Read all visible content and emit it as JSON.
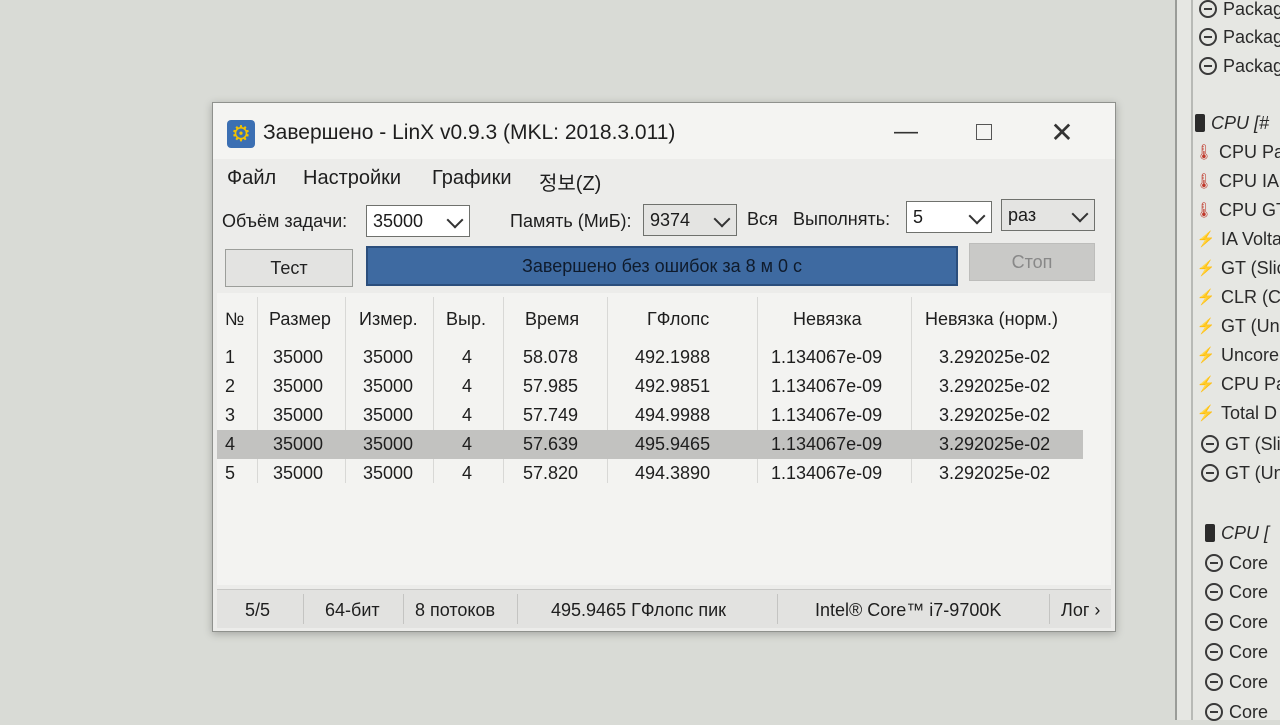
{
  "window": {
    "title": "Завершено - LinX v0.9.3 (MKL: 2018.3.011)",
    "minimize": "—",
    "close": "✕"
  },
  "menu": [
    "Файл",
    "Настройки",
    "Графики",
    "정보(Z)"
  ],
  "controls": {
    "task_size_label": "Объём задачи:",
    "task_size_value": "35000",
    "memory_label": "Память (МиБ):",
    "memory_value": "9374",
    "all_label": "Вся",
    "run_label": "Выполнять:",
    "run_count": "5",
    "run_unit": "раз"
  },
  "buttons": {
    "test": "Тест",
    "stop": "Стоп"
  },
  "progress": {
    "text": "Завершено без ошибок за 8 м 0 с",
    "fraction": 1.0
  },
  "table": {
    "columns": [
      "№",
      "Размер",
      "Измер.",
      "Выр.",
      "Время",
      "ГФлопс",
      "Невязка",
      "Невязка (норм.)"
    ],
    "rows": [
      [
        "1",
        "35000",
        "35000",
        "4",
        "58.078",
        "492.1988",
        "1.134067e-09",
        "3.292025e-02"
      ],
      [
        "2",
        "35000",
        "35000",
        "4",
        "57.985",
        "492.9851",
        "1.134067e-09",
        "3.292025e-02"
      ],
      [
        "3",
        "35000",
        "35000",
        "4",
        "57.749",
        "494.9988",
        "1.134067e-09",
        "3.292025e-02"
      ],
      [
        "4",
        "35000",
        "35000",
        "4",
        "57.639",
        "495.9465",
        "1.134067e-09",
        "3.292025e-02"
      ],
      [
        "5",
        "35000",
        "35000",
        "4",
        "57.820",
        "494.3890",
        "1.134067e-09",
        "3.292025e-02"
      ]
    ],
    "selected_row": 4
  },
  "status": {
    "progress": "5/5",
    "bits": "64-бит",
    "threads": "8 потоков",
    "peak": "495.9465 ГФлопс пик",
    "cpu": "Intel® Core™ i7-9700K",
    "log": "Лог ›"
  },
  "side_panel": {
    "items": [
      {
        "icon": "minus-circle-icon",
        "label": "Package"
      },
      {
        "icon": "minus-circle-icon",
        "label": "Package"
      },
      {
        "icon": "minus-circle-icon",
        "label": "Package"
      },
      {
        "icon": "chip-icon",
        "label": "CPU [#"
      },
      {
        "icon": "thermometer-icon",
        "label": "CPU Pac"
      },
      {
        "icon": "thermometer-icon",
        "label": "CPU IA"
      },
      {
        "icon": "thermometer-icon",
        "label": "CPU GT"
      },
      {
        "icon": "lightning-icon",
        "label": "IA Volta"
      },
      {
        "icon": "lightning-icon",
        "label": "GT (Slic"
      },
      {
        "icon": "lightning-icon",
        "label": "CLR (C"
      },
      {
        "icon": "lightning-icon",
        "label": "GT (Un"
      },
      {
        "icon": "lightning-icon",
        "label": "Uncore"
      },
      {
        "icon": "lightning-icon",
        "label": "CPU Pa"
      },
      {
        "icon": "lightning-icon",
        "label": "Total D"
      },
      {
        "icon": "minus-circle-icon",
        "label": "GT (Slic"
      },
      {
        "icon": "minus-circle-icon",
        "label": "GT (Un"
      },
      {
        "icon": "chip-icon",
        "label": "CPU ["
      },
      {
        "icon": "minus-circle-icon",
        "label": "Core"
      },
      {
        "icon": "minus-circle-icon",
        "label": "Core"
      },
      {
        "icon": "minus-circle-icon",
        "label": "Core"
      },
      {
        "icon": "minus-circle-icon",
        "label": "Core"
      },
      {
        "icon": "minus-circle-icon",
        "label": "Core"
      },
      {
        "icon": "minus-circle-icon",
        "label": "Core"
      }
    ]
  }
}
